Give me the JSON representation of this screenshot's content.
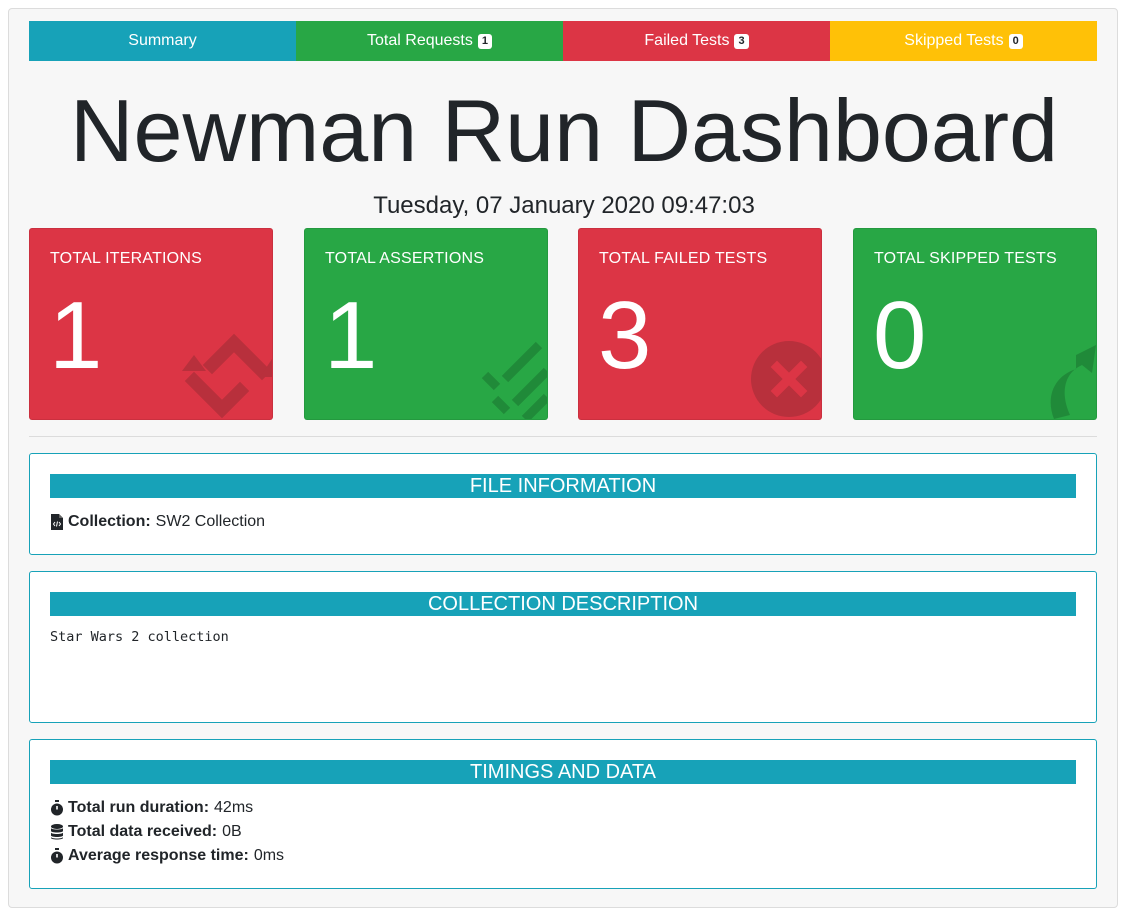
{
  "tabs": [
    {
      "label": "Summary",
      "badge": ""
    },
    {
      "label": "Total Requests",
      "badge": "1"
    },
    {
      "label": "Failed Tests",
      "badge": "3"
    },
    {
      "label": "Skipped Tests",
      "badge": "0"
    }
  ],
  "title": "Newman Run Dashboard",
  "date": "Tuesday, 07 January 2020 09:47:03",
  "cards": [
    {
      "label": "TOTAL ITERATIONS",
      "value": "1"
    },
    {
      "label": "TOTAL ASSERTIONS",
      "value": "1"
    },
    {
      "label": "TOTAL FAILED TESTS",
      "value": "3"
    },
    {
      "label": "TOTAL SKIPPED TESTS",
      "value": "0"
    }
  ],
  "file_info": {
    "heading": "FILE INFORMATION",
    "collection_label": "Collection:",
    "collection_value": "SW2 Collection"
  },
  "collection_description": {
    "heading": "COLLECTION DESCRIPTION",
    "text": "Star Wars 2 collection"
  },
  "timings": {
    "heading": "TIMINGS AND DATA",
    "duration_label": "Total run duration:",
    "duration_value": "42ms",
    "data_label": "Total data received:",
    "data_value": "0B",
    "response_label": "Average response time:",
    "response_value": "0ms"
  },
  "colors": {
    "info": "#17a2b8",
    "success": "#28a745",
    "danger": "#dc3545",
    "warning": "#ffc107"
  },
  "icons": {
    "iterations": "refresh-icon",
    "assertions": "tasks-icon",
    "failed": "times-circle-icon",
    "skipped": "share-arrow-icon",
    "collection": "file-code-icon",
    "duration": "stopwatch-icon",
    "data": "database-icon",
    "response": "stopwatch-icon"
  }
}
